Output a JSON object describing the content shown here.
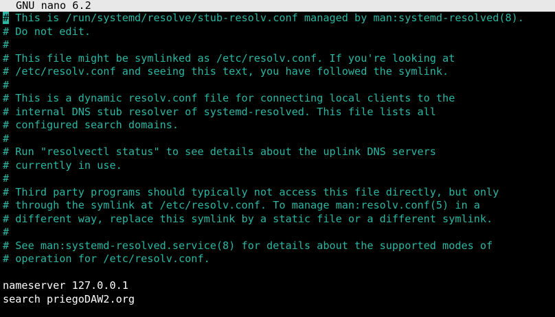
{
  "window": {
    "title": "GNU nano 6.2"
  },
  "colors": {
    "background": "#000000",
    "comment": "#2bb7a4",
    "text": "#ffffff",
    "titlebar_bg": "#e8e8e8"
  },
  "editor": {
    "cursor_char": "#",
    "lines": [
      " This is /run/systemd/resolve/stub-resolv.conf managed by man:systemd-resolved(8).",
      "# Do not edit.",
      "#",
      "# This file might be symlinked as /etc/resolv.conf. If you're looking at",
      "# /etc/resolv.conf and seeing this text, you have followed the symlink.",
      "#",
      "# This is a dynamic resolv.conf file for connecting local clients to the",
      "# internal DNS stub resolver of systemd-resolved. This file lists all",
      "# configured search domains.",
      "#",
      "# Run \"resolvectl status\" to see details about the uplink DNS servers",
      "# currently in use.",
      "#",
      "# Third party programs should typically not access this file directly, but only",
      "# through the symlink at /etc/resolv.conf. To manage man:resolv.conf(5) in a",
      "# different way, replace this symlink by a static file or a different symlink.",
      "#",
      "# See man:systemd-resolved.service(8) for details about the supported modes of",
      "# operation for /etc/resolv.conf.",
      "",
      "nameserver 127.0.0.1",
      "search priegoDAW2.org"
    ]
  }
}
